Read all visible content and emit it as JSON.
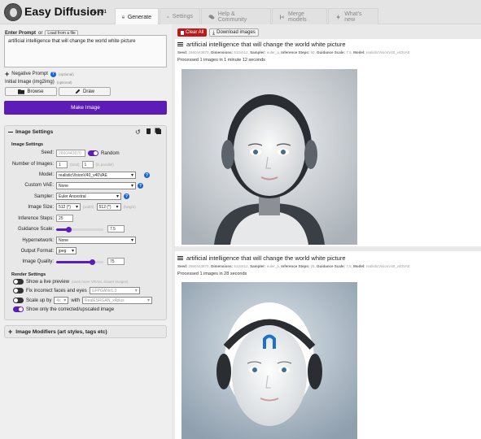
{
  "app": {
    "title": "Easy Diffusion",
    "version": "v2.5.41"
  },
  "tabs": [
    {
      "label": "Generate",
      "icon": "image-icon",
      "active": true
    },
    {
      "label": "Settings",
      "icon": "gear-icon"
    },
    {
      "label": "Help & Community",
      "icon": "chat-icon"
    },
    {
      "label": "Merge models",
      "icon": "merge-icon"
    },
    {
      "label": "What's new",
      "icon": "bolt-icon"
    }
  ],
  "prompt": {
    "label": "Enter Prompt",
    "or": "or",
    "load_file": "Load from a file",
    "value": "artificial intelligence that will change the world white picture"
  },
  "negative_prompt": {
    "label": "Negative Prompt",
    "hint": "(optional)"
  },
  "initial_image": {
    "label": "Initial Image (img2img)",
    "hint": "(optional)",
    "browse": "Browse",
    "draw": "Draw"
  },
  "make_image": "Make Image",
  "image_settings": {
    "title": "Image Settings",
    "subtitle": "Image Settings",
    "seed": {
      "label": "Seed:",
      "value": "2660443870",
      "random": "Random"
    },
    "num_images": {
      "label": "Number of Images:",
      "total": "1",
      "total_hint": "(total)",
      "parallel": "1",
      "parallel_hint": "(in parallel)"
    },
    "model": {
      "label": "Model:",
      "value": "realisticVisionV40_v40VAE"
    },
    "vae": {
      "label": "Custom VAE:",
      "value": "None"
    },
    "sampler": {
      "label": "Sampler:",
      "value": "Euler Ancestral"
    },
    "image_size": {
      "label": "Image Size:",
      "width": "512 (*)",
      "width_hint": "(width)",
      "height": "512 (*)",
      "height_hint": "(height)"
    },
    "steps": {
      "label": "Inference Steps:",
      "value": "25"
    },
    "guidance": {
      "label": "Guidance Scale:",
      "value": "7.5",
      "fraction": 0.25
    },
    "hypernetwork": {
      "label": "Hypernetwork:",
      "value": "None"
    },
    "output_format": {
      "label": "Output Format:",
      "value": "jpeg"
    },
    "image_quality": {
      "label": "Image Quality:",
      "value": "75",
      "fraction": 0.75
    }
  },
  "render_settings": {
    "title": "Render Settings",
    "live_preview": "Show a live preview",
    "live_preview_hint": "(uses more VRAM, slower images)",
    "fix_faces": "Fix incorrect faces and eyes",
    "fix_faces_model": "GFPGANv1.3",
    "scale_up": "Scale up by",
    "scale_value": "4x",
    "with": "with",
    "scale_model": "RealESRGAN_x4plus",
    "show_only": "Show only the corrected/upscaled image"
  },
  "modifiers": "Image Modifiers (art styles, tags etc)",
  "toolbar": {
    "clear_all": "Clear All",
    "download": "Download images"
  },
  "results": [
    {
      "title": "artificial intelligence that will change the world white picture",
      "seed": "2660443870",
      "dims": "512x512",
      "sampler": "euler_a",
      "steps": "50",
      "guidance": "7.5",
      "model": "realisticVisionV40_v40VAE",
      "processed": "Processed 1 images in 1 minute 12 seconds"
    },
    {
      "title": "artificial intelligence that will change the world white picture",
      "seed": "2660443870",
      "dims": "512x512",
      "sampler": "euler_a",
      "steps": "25",
      "guidance": "7.5",
      "model": "realisticVisionV40_v40VAE",
      "processed": "Processed 1 images in 28 seconds"
    }
  ],
  "meta_labels": {
    "seed": "Seed:",
    "dims": "Dimensions:",
    "sampler": "Sampler:",
    "steps": "Inference Steps:",
    "guidance": "Guidance Scale:",
    "model": "Model:"
  },
  "colors": {
    "accent": "#5c1cb5",
    "danger": "#b71c1c",
    "info": "#1565d8"
  }
}
